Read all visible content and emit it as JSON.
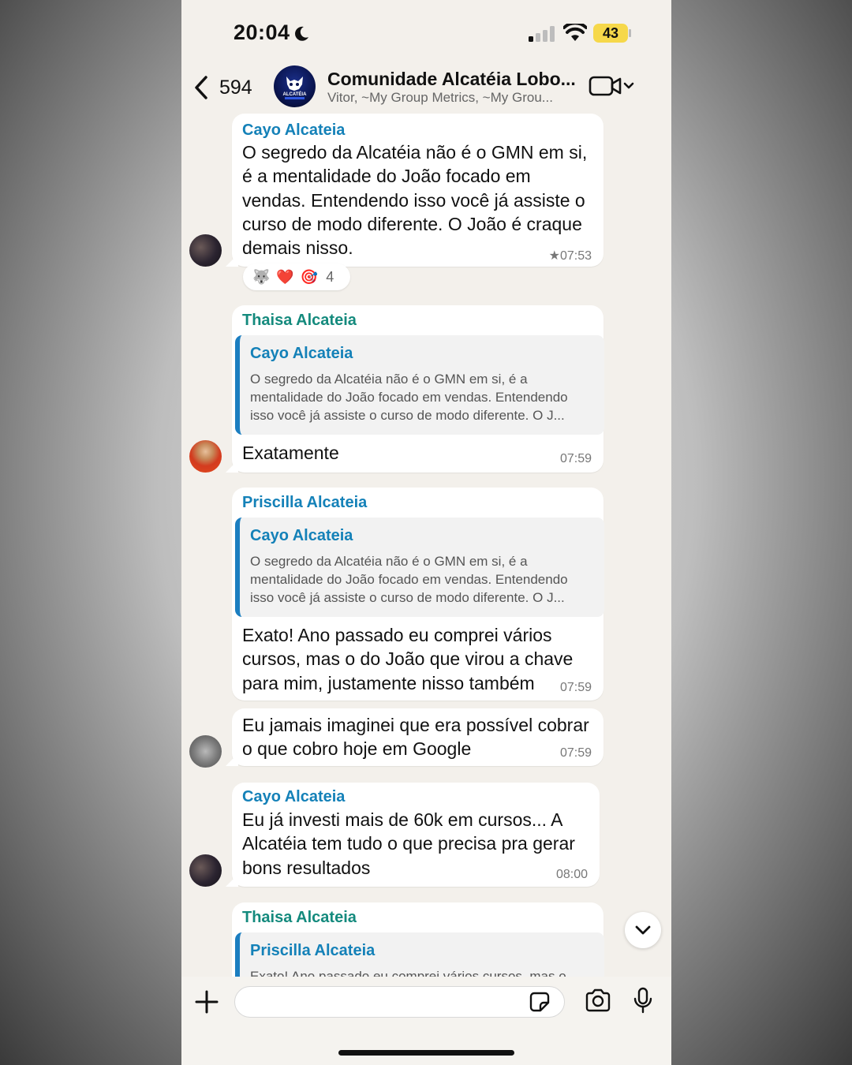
{
  "status_bar": {
    "time": "20:04",
    "battery": "43",
    "battery_color": "#f6d84a"
  },
  "header": {
    "back_count": "594",
    "group_name": "Comunidade Alcatéia Lobo...",
    "members_preview": "Vitor, ~My Group Metrics, ~My Grou...",
    "avatar_text": "ALCATÉIA",
    "icons": [
      "chevron-left-icon",
      "video-camera-icon",
      "chevron-down-icon"
    ]
  },
  "messages": [
    {
      "sender": "Cayo Alcateia",
      "lines": [
        "O segredo da Alcatéia não é o GMN em si,",
        "é a mentalidade do João focado em",
        "vendas. Entendendo isso você já assiste o",
        "curso de modo diferente. O João é craque",
        "demais nisso."
      ],
      "time": "★07:53",
      "reactions": {
        "emojis": [
          "🐺",
          "❤️",
          "🎯"
        ],
        "count": "4"
      }
    },
    {
      "sender": "Thaisa Alcateia",
      "quote": {
        "name": "Cayo Alcateia",
        "lines": [
          "O segredo da Alcatéia não é o GMN em si, é a",
          "mentalidade do João focado em vendas. Entendendo",
          "isso você já assiste o curso de modo diferente. O J..."
        ]
      },
      "lines": [
        "Exatamente"
      ],
      "time": "07:59"
    },
    {
      "sender": "Priscilla Alcateia",
      "quote": {
        "name": "Cayo Alcateia",
        "lines": [
          "O segredo da Alcatéia não é o GMN em si, é a",
          "mentalidade do João focado em vendas. Entendendo",
          "isso você já assiste o curso de modo diferente. O J..."
        ]
      },
      "lines": [
        "Exato! Ano passado eu comprei vários",
        "cursos, mas o do João que virou a chave",
        "para mim, justamente nisso também"
      ],
      "time": "07:59"
    },
    {
      "lines": [
        "Eu jamais imaginei que era possível cobrar",
        "o que cobro hoje em Google"
      ],
      "time": "07:59"
    },
    {
      "sender": "Cayo Alcateia",
      "lines": [
        "Eu já investi mais de 60k em cursos... A",
        "Alcatéia tem tudo o que precisa pra gerar",
        "bons resultados"
      ],
      "time": "08:00"
    },
    {
      "sender": "Thaisa Alcateia",
      "quote": {
        "name": "Priscilla Alcateia",
        "lines": [
          "Exato! Ano passado eu comprei vários cursos, mas o"
        ]
      }
    }
  ],
  "input": {
    "placeholder": "",
    "icons": [
      "plus-icon",
      "sticker-icon",
      "camera-icon",
      "microphone-icon"
    ]
  },
  "colors": {
    "chat_background": "#f3f0eb",
    "sender_blue": "#1481b8",
    "sender_green": "#148a7d",
    "quote_bar": "#1b7ec0"
  }
}
